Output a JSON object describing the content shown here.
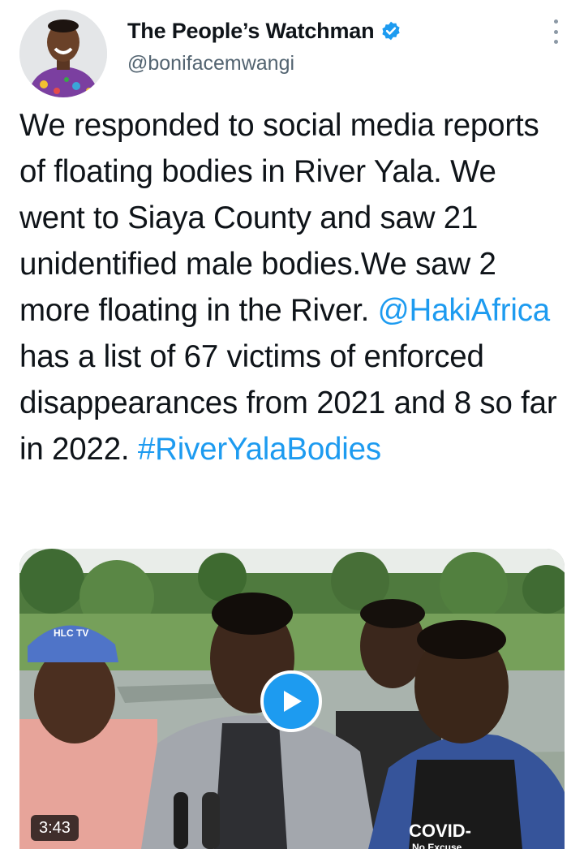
{
  "author": {
    "display_name": "The People’s Watchman",
    "handle": "@bonifacemwangi",
    "verified": true
  },
  "tweet": {
    "segments": [
      {
        "text": "We responded to social media reports of floating bodies in River Yala. We went to Siaya County and saw 21 unidentified male bodies.We saw 2 more floating in the River. ",
        "type": "text"
      },
      {
        "text": "@HakiAfrica",
        "type": "mention"
      },
      {
        "text": " has a list of 67 victims of enforced disappearances from 2021 and 8 so far in 2022. ",
        "type": "text"
      },
      {
        "text": "#RiverYalaBodies",
        "type": "hashtag"
      }
    ]
  },
  "media": {
    "type": "video",
    "duration": "3:43",
    "cap_text": "HLC TV",
    "shirt_text": "COVID-",
    "shirt_subtext": "No Excuse"
  },
  "icons": {
    "verified": "verified-badge-icon",
    "more": "more-options-icon",
    "play": "play-icon"
  },
  "colors": {
    "accent": "#1d9bf0",
    "text": "#0f1419",
    "secondary": "#536471"
  }
}
